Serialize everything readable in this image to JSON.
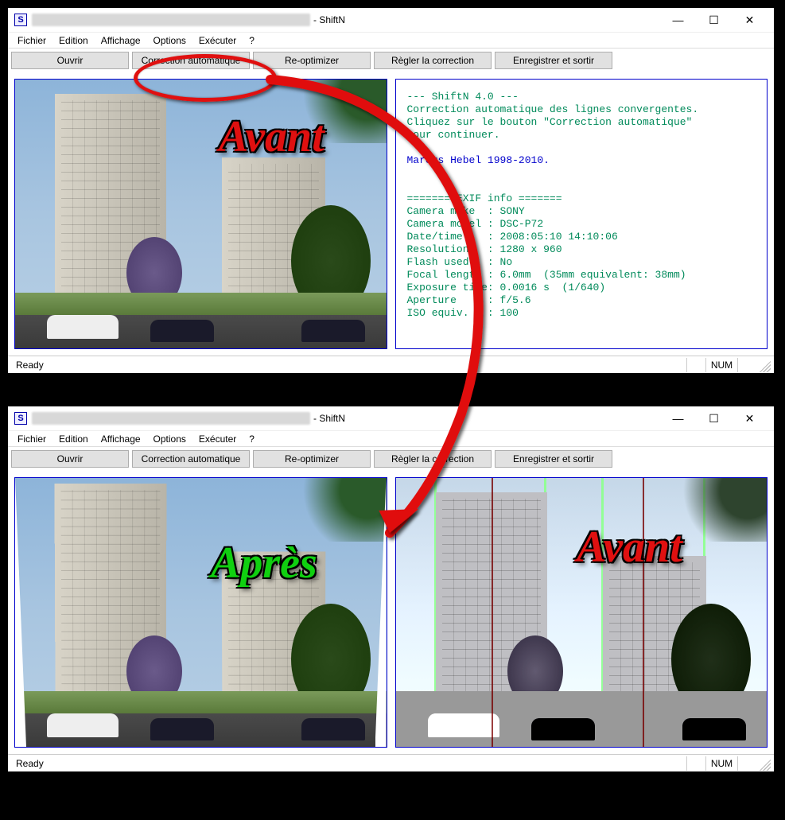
{
  "overlay": {
    "before_label": "Avant",
    "after_label": "Après"
  },
  "window": {
    "icon_letter": "S",
    "title_suffix": " - ShiftN",
    "sys": {
      "min": "—",
      "max": "☐",
      "close": "✕"
    }
  },
  "menu": {
    "items": [
      "Fichier",
      "Edition",
      "Affichage",
      "Options",
      "Exécuter",
      "?"
    ]
  },
  "toolbar": {
    "open": "Ouvrir",
    "auto": "Correction automatique",
    "reopt": "Re-optimizer",
    "adjust": "Règler la correction",
    "save": "Enregistrer et sortir"
  },
  "info": {
    "header": "--- ShiftN 4.0 ---",
    "line1": "Correction automatique des lignes convergentes.",
    "line2": "Cliquez sur le bouton \"Correction automatique\"",
    "line3": "pour continuer.",
    "credit": "Marcus Hebel 1998-2010.",
    "exif_header": "======= EXIF info =======",
    "exif": {
      "make": "Camera make  : SONY",
      "model": "Camera model : DSC-P72",
      "date": "Date/time    : 2008:05:10 14:10:06",
      "res": "Resolution   : 1280 x 960",
      "flash": "Flash used   : No",
      "focal": "Focal length : 6.0mm  (35mm equivalent: 38mm)",
      "exp": "Exposure time: 0.0016 s  (1/640)",
      "apert": "Aperture     : f/5.6",
      "iso": "ISO equiv.   : 100"
    }
  },
  "status": {
    "ready": "Ready",
    "num": "NUM"
  }
}
